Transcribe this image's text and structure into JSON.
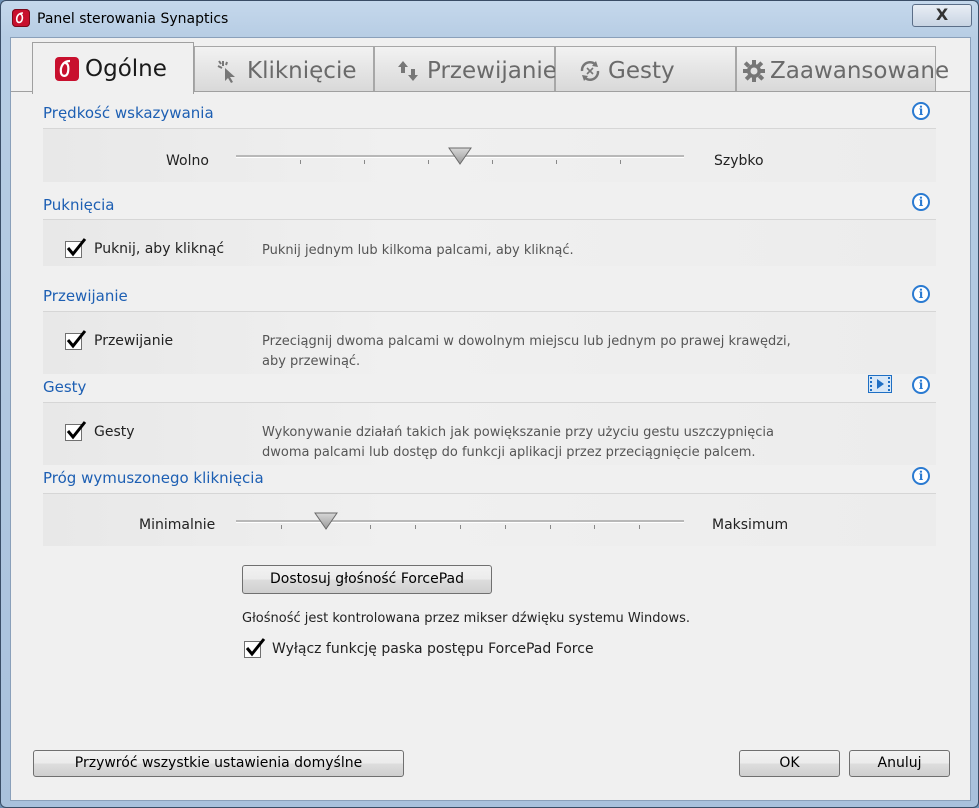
{
  "window": {
    "title": "Panel sterowania Synaptics",
    "close_label": "X"
  },
  "tabs": [
    {
      "label": "Ogólne",
      "icon": "synaptics-logo-icon",
      "active": true
    },
    {
      "label": "Kliknięcie",
      "icon": "click-icon",
      "active": false
    },
    {
      "label": "Przewijanie",
      "icon": "scroll-arrows-icon",
      "active": false
    },
    {
      "label": "Gesty",
      "icon": "gesture-icon",
      "active": false
    },
    {
      "label": "Zaawansowane",
      "icon": "gear-icon",
      "active": false
    }
  ],
  "pointing_speed": {
    "title": "Prędkość wskazywania",
    "min_label": "Wolno",
    "max_label": "Szybko",
    "value": 0.5,
    "ticks": 7
  },
  "tap": {
    "title": "Puknięcia",
    "checkbox_label": "Puknij, aby kliknąć",
    "checked": true,
    "description": "Puknij jednym lub kilkoma palcami, aby kliknąć."
  },
  "scrolling": {
    "title": "Przewijanie",
    "checkbox_label": "Przewijanie",
    "checked": true,
    "description_line1": "Przeciągnij dwoma palcami w dowolnym miejscu lub jednym po prawej krawędzi,",
    "description_line2": "aby przewinąć."
  },
  "gestures": {
    "title": "Gesty",
    "checkbox_label": "Gesty",
    "checked": true,
    "description_line1": "Wykonywanie działań takich jak powiększanie przy użyciu gestu uszczypnięcia",
    "description_line2": "dwoma palcami lub dostęp do funkcji aplikacji przez przeciągnięcie palcem."
  },
  "force_click": {
    "title": "Próg wymuszonego kliknięcia",
    "min_label": "Minimalnie",
    "max_label": "Maksimum",
    "value": 0.2,
    "ticks": 10,
    "volume_button": "Dostosuj głośność ForcePad",
    "volume_note": "Głośność jest kontrolowana przez mikser dźwięku systemu Windows.",
    "progress_checkbox_label": "Wyłącz funkcję paska postępu ForcePad Force",
    "progress_checked": true
  },
  "footer": {
    "restore_label": "Przywróć wszystkie ustawienia domyślne",
    "ok_label": "OK",
    "cancel_label": "Anuluj"
  },
  "colors": {
    "accent": "#1d5fb3",
    "info": "#2a7ad1",
    "brand": "#c8102e"
  }
}
